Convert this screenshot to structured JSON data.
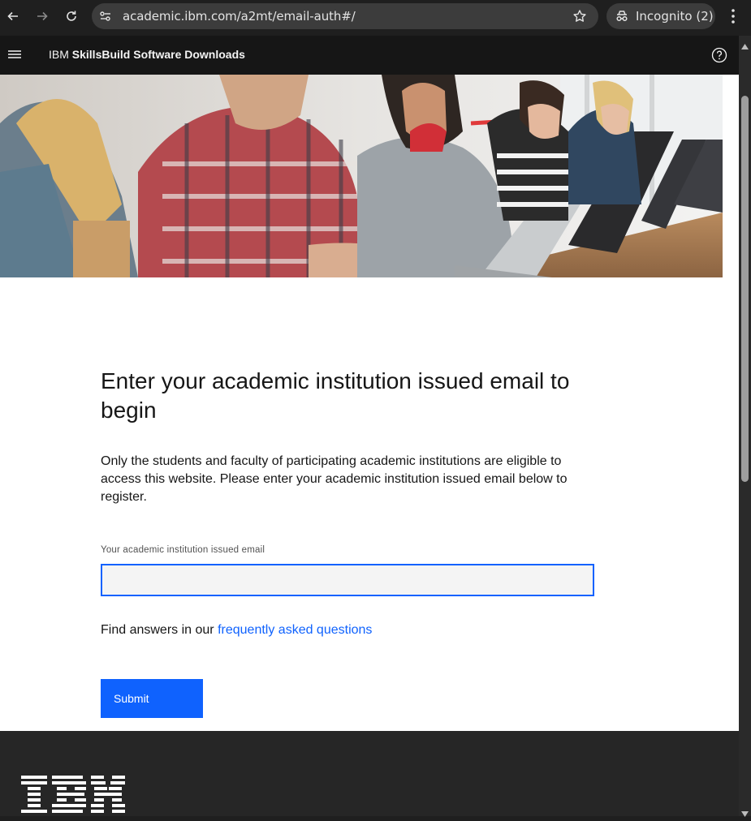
{
  "browser": {
    "url": "academic.ibm.com/a2mt/email-auth#/",
    "incognito_label": "Incognito (2)",
    "icons": [
      "back-icon",
      "forward-icon",
      "reload-icon",
      "site-info-icon",
      "bookmark-star-icon",
      "incognito-icon",
      "more-vert-icon"
    ]
  },
  "masthead": {
    "brand_prefix": "IBM",
    "brand_name": "SkillsBuild Software Downloads",
    "icons": [
      "hamburger-menu-icon",
      "help-icon"
    ]
  },
  "main": {
    "heading": "Enter your academic institution issued email to begin",
    "description": "Only the students and faculty of participating academic institutions are eligible to access this website. Please enter your academic institution issued email below to register.",
    "email_label": "Your academic institution issued email",
    "email_value": "",
    "faq_prefix": "Find answers in our",
    "faq_link": "frequently asked questions",
    "submit_label": "Submit"
  },
  "footer": {
    "logo": "IBM"
  },
  "colors": {
    "accent": "#0f62fe",
    "masthead_bg": "#161616",
    "footer_bg": "#262626"
  }
}
